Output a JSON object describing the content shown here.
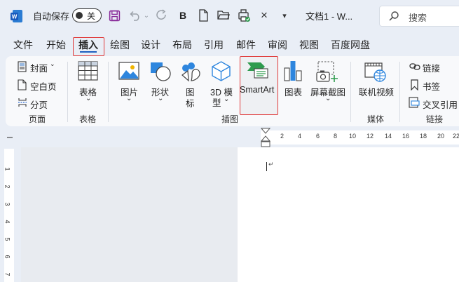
{
  "titlebar": {
    "autosave_label": "自动保存",
    "autosave_state": "关",
    "bold_label": "B",
    "document_title": "文档1 - W...",
    "search_placeholder": "搜索"
  },
  "tabs": [
    "文件",
    "开始",
    "插入",
    "绘图",
    "设计",
    "布局",
    "引用",
    "邮件",
    "审阅",
    "视图",
    "百度网盘"
  ],
  "active_tab": "插入",
  "ribbon": {
    "pages": {
      "cover": "封面",
      "blank": "空白页",
      "break": "分页",
      "group": "页面"
    },
    "tables": {
      "table": "表格",
      "group": "表格"
    },
    "illustrations": {
      "picture": "图片",
      "shapes": "形状",
      "icons_1": "图",
      "icons_2": "标",
      "model_1": "3D 模",
      "model_2": "型",
      "smartart": "SmartArt",
      "chart": "图表",
      "screenshot": "屏幕截图",
      "group": "插图"
    },
    "media": {
      "online_video": "联机视频",
      "group": "媒体"
    },
    "links": {
      "link": "链接",
      "bookmark": "书签",
      "cross_ref": "交叉引用",
      "group": "链接"
    }
  },
  "ruler": {
    "horizontal": [
      "2",
      "4",
      "6",
      "8",
      "10",
      "12",
      "14",
      "16",
      "18",
      "20",
      "22"
    ],
    "vertical": [
      "1",
      "2",
      "3",
      "4",
      "5",
      "6",
      "7"
    ]
  },
  "document": {
    "paragraph_mark": "↵"
  },
  "colors": {
    "accent": "#1f5fbf",
    "highlight_border": "#e03a3a",
    "word_blue": "#185abd"
  }
}
